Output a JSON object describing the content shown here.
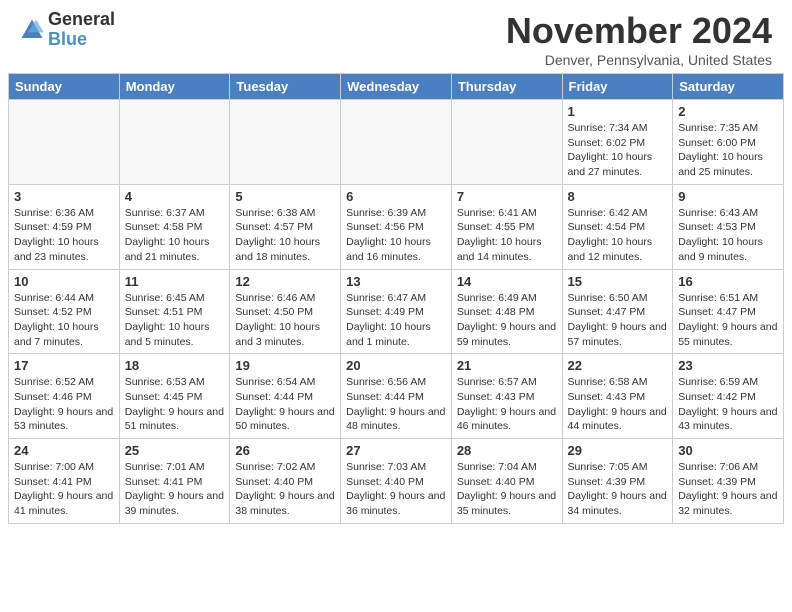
{
  "logo": {
    "general": "General",
    "blue": "Blue"
  },
  "title": "November 2024",
  "location": "Denver, Pennsylvania, United States",
  "days_of_week": [
    "Sunday",
    "Monday",
    "Tuesday",
    "Wednesday",
    "Thursday",
    "Friday",
    "Saturday"
  ],
  "weeks": [
    [
      {
        "day": "",
        "info": ""
      },
      {
        "day": "",
        "info": ""
      },
      {
        "day": "",
        "info": ""
      },
      {
        "day": "",
        "info": ""
      },
      {
        "day": "",
        "info": ""
      },
      {
        "day": "1",
        "info": "Sunrise: 7:34 AM\nSunset: 6:02 PM\nDaylight: 10 hours and 27 minutes."
      },
      {
        "day": "2",
        "info": "Sunrise: 7:35 AM\nSunset: 6:00 PM\nDaylight: 10 hours and 25 minutes."
      }
    ],
    [
      {
        "day": "3",
        "info": "Sunrise: 6:36 AM\nSunset: 4:59 PM\nDaylight: 10 hours and 23 minutes."
      },
      {
        "day": "4",
        "info": "Sunrise: 6:37 AM\nSunset: 4:58 PM\nDaylight: 10 hours and 21 minutes."
      },
      {
        "day": "5",
        "info": "Sunrise: 6:38 AM\nSunset: 4:57 PM\nDaylight: 10 hours and 18 minutes."
      },
      {
        "day": "6",
        "info": "Sunrise: 6:39 AM\nSunset: 4:56 PM\nDaylight: 10 hours and 16 minutes."
      },
      {
        "day": "7",
        "info": "Sunrise: 6:41 AM\nSunset: 4:55 PM\nDaylight: 10 hours and 14 minutes."
      },
      {
        "day": "8",
        "info": "Sunrise: 6:42 AM\nSunset: 4:54 PM\nDaylight: 10 hours and 12 minutes."
      },
      {
        "day": "9",
        "info": "Sunrise: 6:43 AM\nSunset: 4:53 PM\nDaylight: 10 hours and 9 minutes."
      }
    ],
    [
      {
        "day": "10",
        "info": "Sunrise: 6:44 AM\nSunset: 4:52 PM\nDaylight: 10 hours and 7 minutes."
      },
      {
        "day": "11",
        "info": "Sunrise: 6:45 AM\nSunset: 4:51 PM\nDaylight: 10 hours and 5 minutes."
      },
      {
        "day": "12",
        "info": "Sunrise: 6:46 AM\nSunset: 4:50 PM\nDaylight: 10 hours and 3 minutes."
      },
      {
        "day": "13",
        "info": "Sunrise: 6:47 AM\nSunset: 4:49 PM\nDaylight: 10 hours and 1 minute."
      },
      {
        "day": "14",
        "info": "Sunrise: 6:49 AM\nSunset: 4:48 PM\nDaylight: 9 hours and 59 minutes."
      },
      {
        "day": "15",
        "info": "Sunrise: 6:50 AM\nSunset: 4:47 PM\nDaylight: 9 hours and 57 minutes."
      },
      {
        "day": "16",
        "info": "Sunrise: 6:51 AM\nSunset: 4:47 PM\nDaylight: 9 hours and 55 minutes."
      }
    ],
    [
      {
        "day": "17",
        "info": "Sunrise: 6:52 AM\nSunset: 4:46 PM\nDaylight: 9 hours and 53 minutes."
      },
      {
        "day": "18",
        "info": "Sunrise: 6:53 AM\nSunset: 4:45 PM\nDaylight: 9 hours and 51 minutes."
      },
      {
        "day": "19",
        "info": "Sunrise: 6:54 AM\nSunset: 4:44 PM\nDaylight: 9 hours and 50 minutes."
      },
      {
        "day": "20",
        "info": "Sunrise: 6:56 AM\nSunset: 4:44 PM\nDaylight: 9 hours and 48 minutes."
      },
      {
        "day": "21",
        "info": "Sunrise: 6:57 AM\nSunset: 4:43 PM\nDaylight: 9 hours and 46 minutes."
      },
      {
        "day": "22",
        "info": "Sunrise: 6:58 AM\nSunset: 4:43 PM\nDaylight: 9 hours and 44 minutes."
      },
      {
        "day": "23",
        "info": "Sunrise: 6:59 AM\nSunset: 4:42 PM\nDaylight: 9 hours and 43 minutes."
      }
    ],
    [
      {
        "day": "24",
        "info": "Sunrise: 7:00 AM\nSunset: 4:41 PM\nDaylight: 9 hours and 41 minutes."
      },
      {
        "day": "25",
        "info": "Sunrise: 7:01 AM\nSunset: 4:41 PM\nDaylight: 9 hours and 39 minutes."
      },
      {
        "day": "26",
        "info": "Sunrise: 7:02 AM\nSunset: 4:40 PM\nDaylight: 9 hours and 38 minutes."
      },
      {
        "day": "27",
        "info": "Sunrise: 7:03 AM\nSunset: 4:40 PM\nDaylight: 9 hours and 36 minutes."
      },
      {
        "day": "28",
        "info": "Sunrise: 7:04 AM\nSunset: 4:40 PM\nDaylight: 9 hours and 35 minutes."
      },
      {
        "day": "29",
        "info": "Sunrise: 7:05 AM\nSunset: 4:39 PM\nDaylight: 9 hours and 34 minutes."
      },
      {
        "day": "30",
        "info": "Sunrise: 7:06 AM\nSunset: 4:39 PM\nDaylight: 9 hours and 32 minutes."
      }
    ]
  ]
}
